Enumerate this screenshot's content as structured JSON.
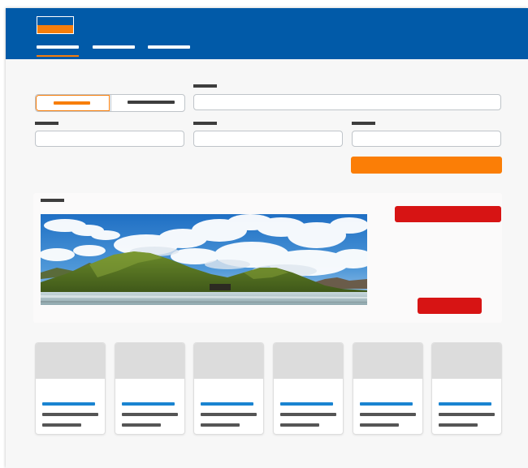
{
  "header": {
    "brand_colors": {
      "primary": "#015aa8",
      "accent": "#f77e0b"
    },
    "logo_icon": "brand-logo-icon",
    "nav_items": [
      {
        "id": "nav-item-1",
        "active": true
      },
      {
        "id": "nav-item-2",
        "active": false
      },
      {
        "id": "nav-item-3",
        "active": false
      }
    ]
  },
  "search_form": {
    "segments": [
      {
        "id": "segment-option-1",
        "selected": true
      },
      {
        "id": "segment-option-2",
        "selected": false
      }
    ],
    "fields": [
      {
        "id": "field-top",
        "value": ""
      },
      {
        "id": "field-1",
        "value": ""
      },
      {
        "id": "field-2",
        "value": ""
      },
      {
        "id": "field-3",
        "value": ""
      }
    ],
    "submit_color": "#fb7e06"
  },
  "promo": {
    "image_subject": "landscape-mountains-lake-clouds",
    "cta_color": "#d71414"
  },
  "cards": [
    {
      "id": "card-1"
    },
    {
      "id": "card-2"
    },
    {
      "id": "card-3"
    },
    {
      "id": "card-4"
    },
    {
      "id": "card-5"
    },
    {
      "id": "card-6"
    }
  ]
}
